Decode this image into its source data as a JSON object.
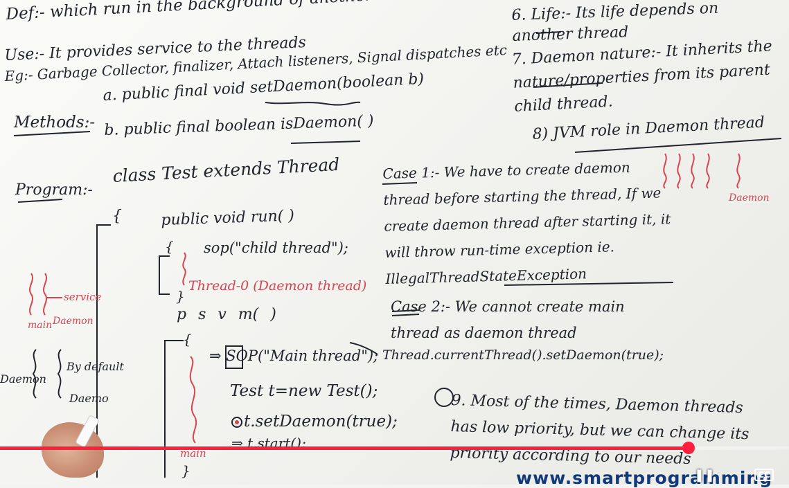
{
  "player": {
    "progress_percent": 87.3,
    "pause_icon": "pause-icon",
    "cc_label": "CC",
    "watermark": "www.smartprogramming"
  },
  "board": {
    "def": "Def:- which run in the background of another thread",
    "use": "Use:- It provides service to the threads",
    "eg": "Eg:- Garbage Collector, finalizer, Attach listeners, Signal dispatches etc",
    "methods_label": "Methods:-",
    "method_a": "a. public final void setDaemon(boolean b)",
    "method_b": "b. public final boolean isDaemon( )",
    "program_label": "Program:-",
    "code_class": "class Test extends Thread",
    "code_brace_open": "{",
    "code_run": "public void run( )",
    "code_run_brace": "{",
    "code_sop_child": "sop(\"child thread\");",
    "code_thread0": "Thread-0 (Daemon thread)",
    "code_run_close": "}",
    "code_psvm": "p s v m(      )",
    "code_main_brace": "{",
    "code_sop_main": "⇒ SOP(\"Main thread\");",
    "code_new_test": "Test t=new Test();",
    "code_set_daemon": "t.setDaemon(true);",
    "code_start": "⇒ t.start();",
    "code_main_label": "main",
    "code_final_brace": "}",
    "side_service": "service",
    "side_main": "main",
    "side_daemon": "Daemon",
    "side_daemon2": "Daemon",
    "side_by_default": "By default",
    "side_daemo": "Daemo",
    "point6": "6. Life:- Its life depends on another thread",
    "point7": "7. Daemon nature:- It inherits the nature/properties from its parent child thread.",
    "point8": "8) JVM role in Daemon thread",
    "daemon_right": "Daemon",
    "case1": "Case 1:- We have to create daemon thread before starting the thread, If we create daemon thread after starting it, it will throw run-time exception ie. IllegalThreadStateException",
    "case2": "Case 2:- We cannot create main thread as daemon thread",
    "current_thread": "Thread.currentThread().setDaemon(true);",
    "point9": "9. Most of the times, Daemon threads has low priority, but we can change its priority according to our needs"
  }
}
